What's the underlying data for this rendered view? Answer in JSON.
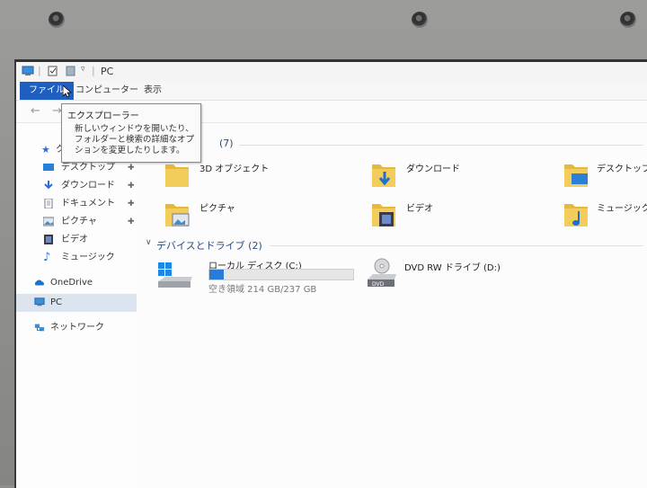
{
  "window": {
    "title": "PC"
  },
  "ribbon": {
    "tabs": [
      {
        "label": "ファイル",
        "active": true
      },
      {
        "label": "コンピューター",
        "active": false
      },
      {
        "label": "表示",
        "active": false
      }
    ]
  },
  "tooltip": {
    "title": "エクスプローラー",
    "body": "新しいウィンドウを開いたり、フォルダーと検索の詳細なオプションを変更したりします。"
  },
  "sidebar": {
    "quick_access_label": "ク",
    "items": [
      {
        "label": "デスクトップ",
        "pinned": true,
        "icon": "desktop-icon"
      },
      {
        "label": "ダウンロード",
        "pinned": true,
        "icon": "download-icon"
      },
      {
        "label": "ドキュメント",
        "pinned": true,
        "icon": "document-icon"
      },
      {
        "label": "ピクチャ",
        "pinned": true,
        "icon": "picture-icon"
      },
      {
        "label": "ビデオ",
        "pinned": false,
        "icon": "video-icon"
      },
      {
        "label": "ミュージック",
        "pinned": false,
        "icon": "music-icon"
      },
      {
        "label": "OneDrive",
        "pinned": false,
        "icon": "onedrive-icon"
      },
      {
        "label": "PC",
        "pinned": false,
        "icon": "pc-icon",
        "selected": true
      },
      {
        "label": "ネットワーク",
        "pinned": false,
        "icon": "network-icon"
      }
    ],
    "pin_glyph": "📌"
  },
  "content": {
    "folders_header": "(7)",
    "folders": [
      {
        "label": "3D オブジェクト",
        "icon": "3d-objects-folder-icon"
      },
      {
        "label": "ダウンロード",
        "icon": "downloads-folder-icon"
      },
      {
        "label": "デスクトップ",
        "icon": "desktop-folder-icon"
      },
      {
        "label": "ピクチャ",
        "icon": "pictures-folder-icon"
      },
      {
        "label": "ビデオ",
        "icon": "videos-folder-icon"
      },
      {
        "label": "ミュージック",
        "icon": "music-folder-icon"
      }
    ],
    "devices_header": "デバイスとドライブ (2)",
    "drives": [
      {
        "label": "ローカル ディスク (C:)",
        "free_text": "空き領域 214 GB/237 GB",
        "used_fraction": 0.097,
        "icon": "windows-drive-icon"
      },
      {
        "label": "DVD RW ドライブ (D:)",
        "icon": "dvd-drive-icon"
      }
    ]
  },
  "colors": {
    "accent": "#1f5fbf",
    "bar_fill": "#2a7bd6",
    "folder": "#f0c750",
    "selected": "#dbe4ef"
  }
}
